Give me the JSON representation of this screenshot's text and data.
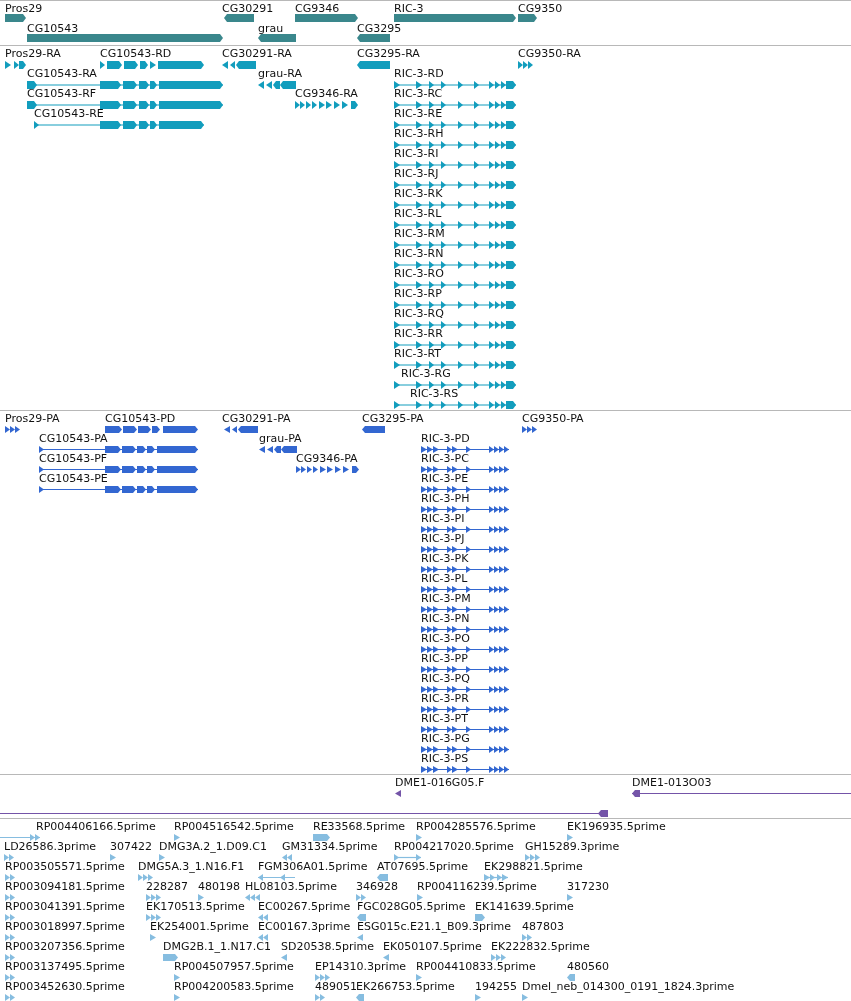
{
  "tracks": [
    {
      "kind": "gene",
      "features": [
        {
          "label": "Pros29",
          "reverse": false
        },
        {
          "label": "CG30291",
          "reverse": true
        },
        {
          "label": "CG9346",
          "reverse": false
        },
        {
          "label": "RIC-3",
          "reverse": false
        },
        {
          "label": "CG9350",
          "reverse": false
        },
        {
          "label": "CG10543",
          "reverse": false
        },
        {
          "label": "grau",
          "reverse": true
        },
        {
          "label": "CG3295",
          "reverse": true
        }
      ]
    },
    {
      "kind": "transcript",
      "features": [
        {
          "label": "Pros29-RA",
          "reverse": false
        },
        {
          "label": "CG10543-RD",
          "reverse": false
        },
        {
          "label": "CG30291-RA",
          "reverse": true
        },
        {
          "label": "CG3295-RA",
          "reverse": true
        },
        {
          "label": "CG9350-RA",
          "reverse": false
        },
        {
          "label": "CG10543-RA",
          "reverse": false
        },
        {
          "label": "grau-RA",
          "reverse": true
        },
        {
          "label": "RIC-3-RD",
          "reverse": false
        },
        {
          "label": "CG10543-RF",
          "reverse": false
        },
        {
          "label": "CG9346-RA",
          "reverse": false
        },
        {
          "label": "RIC-3-RC",
          "reverse": false
        },
        {
          "label": "CG10543-RE",
          "reverse": false
        },
        {
          "label": "RIC-3-RE",
          "reverse": false
        },
        {
          "label": "RIC-3-RH",
          "reverse": false
        },
        {
          "label": "RIC-3-RI",
          "reverse": false
        },
        {
          "label": "RIC-3-RJ",
          "reverse": false
        },
        {
          "label": "RIC-3-RK",
          "reverse": false
        },
        {
          "label": "RIC-3-RL",
          "reverse": false
        },
        {
          "label": "RIC-3-RM",
          "reverse": false
        },
        {
          "label": "RIC-3-RN",
          "reverse": false
        },
        {
          "label": "RIC-3-RO",
          "reverse": false
        },
        {
          "label": "RIC-3-RP",
          "reverse": false
        },
        {
          "label": "RIC-3-RQ",
          "reverse": false
        },
        {
          "label": "RIC-3-RR",
          "reverse": false
        },
        {
          "label": "RIC-3-RT",
          "reverse": false
        },
        {
          "label": "RIC-3-RG",
          "reverse": false
        },
        {
          "label": "RIC-3-RS",
          "reverse": false
        }
      ]
    },
    {
      "kind": "protein",
      "features": [
        {
          "label": "Pros29-PA",
          "reverse": false
        },
        {
          "label": "CG10543-PD",
          "reverse": false
        },
        {
          "label": "CG30291-PA",
          "reverse": true
        },
        {
          "label": "CG3295-PA",
          "reverse": true
        },
        {
          "label": "CG9350-PA",
          "reverse": false
        },
        {
          "label": "CG10543-PA",
          "reverse": false
        },
        {
          "label": "grau-PA",
          "reverse": true
        },
        {
          "label": "RIC-3-PD",
          "reverse": false
        },
        {
          "label": "CG10543-PF",
          "reverse": false
        },
        {
          "label": "CG9346-PA",
          "reverse": false
        },
        {
          "label": "RIC-3-PC",
          "reverse": false
        },
        {
          "label": "CG10543-PE",
          "reverse": false
        },
        {
          "label": "RIC-3-PE",
          "reverse": false
        },
        {
          "label": "RIC-3-PH",
          "reverse": false
        },
        {
          "label": "RIC-3-PI",
          "reverse": false
        },
        {
          "label": "RIC-3-PJ",
          "reverse": false
        },
        {
          "label": "RIC-3-PK",
          "reverse": false
        },
        {
          "label": "RIC-3-PL",
          "reverse": false
        },
        {
          "label": "RIC-3-PM",
          "reverse": false
        },
        {
          "label": "RIC-3-PN",
          "reverse": false
        },
        {
          "label": "RIC-3-PO",
          "reverse": false
        },
        {
          "label": "RIC-3-PP",
          "reverse": false
        },
        {
          "label": "RIC-3-PQ",
          "reverse": false
        },
        {
          "label": "RIC-3-PR",
          "reverse": false
        },
        {
          "label": "RIC-3-PT",
          "reverse": false
        },
        {
          "label": "RIC-3-PG",
          "reverse": false
        },
        {
          "label": "RIC-3-PS",
          "reverse": false
        }
      ]
    },
    {
      "kind": "clone",
      "features": [
        {
          "label": "DME1-016G05.F",
          "reverse": true
        },
        {
          "label": "DME1-013O03",
          "reverse": true
        },
        {
          "reverse": true
        }
      ]
    },
    {
      "kind": "est",
      "features": [
        {
          "label": "RP004406166.5prime",
          "reverse": false
        },
        {
          "label": "RP004516542.5prime",
          "reverse": false
        },
        {
          "label": "RE33568.5prime",
          "reverse": false
        },
        {
          "label": "RP004285576.5prime",
          "reverse": false
        },
        {
          "label": "EK196935.5prime",
          "reverse": false
        },
        {
          "label": "LD26586.3prime",
          "reverse": false
        },
        {
          "label": "307422",
          "reverse": false
        },
        {
          "label": "DMG3A.2_1.D09.C1",
          "reverse": false
        },
        {
          "label": "GM31334.5prime",
          "reverse": true
        },
        {
          "label": "RP004217020.5prime",
          "reverse": false
        },
        {
          "label": "GH15289.3prime",
          "reverse": false
        },
        {
          "label": "RP003505571.5prime",
          "reverse": false
        },
        {
          "label": "DMG5A.3_1.N16.F1",
          "reverse": false
        },
        {
          "label": "FGM306A01.5prime",
          "reverse": true
        },
        {
          "label": "AT07695.5prime",
          "reverse": true
        },
        {
          "label": "EK298821.5prime",
          "reverse": false
        },
        {
          "label": "RP003094181.5prime",
          "reverse": false
        },
        {
          "label": "228287",
          "reverse": false
        },
        {
          "label": "480198",
          "reverse": false
        },
        {
          "label": "HL08103.5prime",
          "reverse": true
        },
        {
          "label": "346928",
          "reverse": false
        },
        {
          "label": "RP004116239.5prime",
          "reverse": false
        },
        {
          "label": "317230",
          "reverse": false
        },
        {
          "label": "RP003041391.5prime",
          "reverse": false
        },
        {
          "label": "EK170513.5prime",
          "reverse": false
        },
        {
          "label": "EC00267.5prime",
          "reverse": true
        },
        {
          "label": "FGC028G05.5prime",
          "reverse": true
        },
        {
          "label": "EK141639.5prime",
          "reverse": false
        },
        {
          "label": "RP003018997.5prime",
          "reverse": false
        },
        {
          "label": "EK254001.5prime",
          "reverse": false
        },
        {
          "label": "EC00167.3prime",
          "reverse": true
        },
        {
          "label": "ESG015c.E21.1_B09.3prime",
          "reverse": true
        },
        {
          "label": "487803",
          "reverse": false
        },
        {
          "label": "RP003207356.5prime",
          "reverse": false
        },
        {
          "label": "DMG2B.1_1.N17.C1",
          "reverse": false
        },
        {
          "label": "SD20538.5prime",
          "reverse": true
        },
        {
          "label": "EK050107.5prime",
          "reverse": true
        },
        {
          "label": "EK222832.5prime",
          "reverse": false
        },
        {
          "label": "RP003137495.5prime",
          "reverse": false
        },
        {
          "label": "RP004507957.5prime",
          "reverse": false
        },
        {
          "label": "EP14310.3prime",
          "reverse": false
        },
        {
          "label": "RP004410833.5prime",
          "reverse": false
        },
        {
          "label": "480560",
          "reverse": true
        },
        {
          "label": "RP003452630.5prime",
          "reverse": false
        },
        {
          "label": "RP004200583.5prime",
          "reverse": false
        },
        {
          "label": "489051",
          "reverse": false
        },
        {
          "label": "EK266753.5prime",
          "reverse": true
        },
        {
          "label": "194255",
          "reverse": false
        },
        {
          "label": "Dmel_neb_014300_0191_1824.3prime",
          "reverse": false
        }
      ]
    }
  ]
}
